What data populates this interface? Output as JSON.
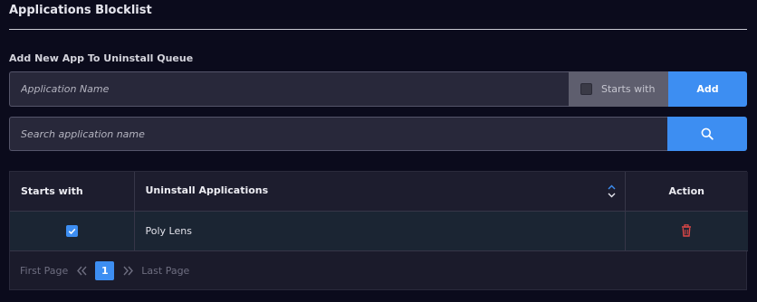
{
  "section": {
    "title": "Applications Blocklist",
    "add_label": "Add New App To Uninstall Queue"
  },
  "add_form": {
    "app_placeholder": "Application Name",
    "starts_with_label": "Starts with",
    "starts_with_checked": false,
    "add_button": "Add"
  },
  "search": {
    "placeholder": "Search application name",
    "icon": "search-icon"
  },
  "table": {
    "headers": {
      "starts_with": "Starts with",
      "apps": "Uninstall Applications",
      "action": "Action"
    },
    "rows": [
      {
        "starts_with": true,
        "name": "Poly Lens",
        "action_icon": "trash-icon"
      }
    ]
  },
  "pagination": {
    "first": "First Page",
    "last": "Last Page",
    "current_page": "1"
  },
  "colors": {
    "background": "#0b0b1c",
    "accent": "#3d8ef2",
    "danger": "#e04848"
  }
}
